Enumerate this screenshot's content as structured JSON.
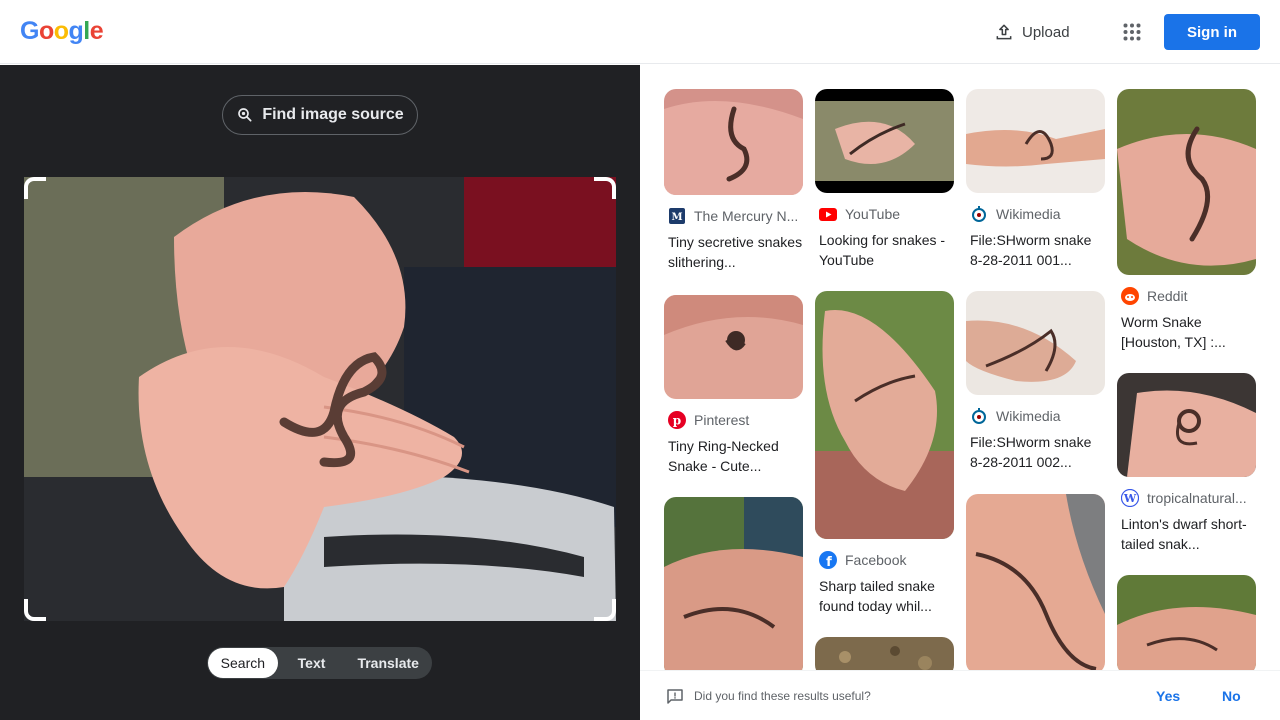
{
  "header": {
    "logo_letters": [
      "G",
      "o",
      "o",
      "g",
      "l",
      "e"
    ],
    "upload_label": "Upload",
    "signin_label": "Sign in"
  },
  "left": {
    "find_source_label": "Find image source",
    "modes": [
      "Search",
      "Text",
      "Translate"
    ],
    "active_mode": "Search"
  },
  "results": [
    {
      "source": "The Mercury N...",
      "icon": "mercury-news-icon",
      "title": "Tiny secretive snakes slithering..."
    },
    {
      "source": "YouTube",
      "icon": "youtube-icon",
      "title": "Looking for snakes - YouTube"
    },
    {
      "source": "Wikimedia",
      "icon": "wikimedia-icon",
      "title": "File:SHworm snake 8-28-2011 001..."
    },
    {
      "source": "Reddit",
      "icon": "reddit-icon",
      "title": "Worm Snake [Houston, TX] :..."
    },
    {
      "source": "Pinterest",
      "icon": "pinterest-icon",
      "title": "Tiny Ring-Necked Snake - Cute..."
    },
    {
      "source": "Facebook",
      "icon": "facebook-icon",
      "title": "Sharp tailed snake found today whil..."
    },
    {
      "source": "Wikimedia",
      "icon": "wikimedia-icon",
      "title": "File:SHworm snake 8-28-2011 002..."
    },
    {
      "source": "tropicalnatural...",
      "icon": "wordpress-icon",
      "title": "Linton's dwarf short-tailed snak..."
    }
  ],
  "feedback": {
    "question": "Did you find these results useful?",
    "yes_label": "Yes",
    "no_label": "No"
  },
  "colors": {
    "accent": "#1a73e8",
    "left_bg": "#202124",
    "text": "#202124",
    "secondary": "#5f6368"
  }
}
